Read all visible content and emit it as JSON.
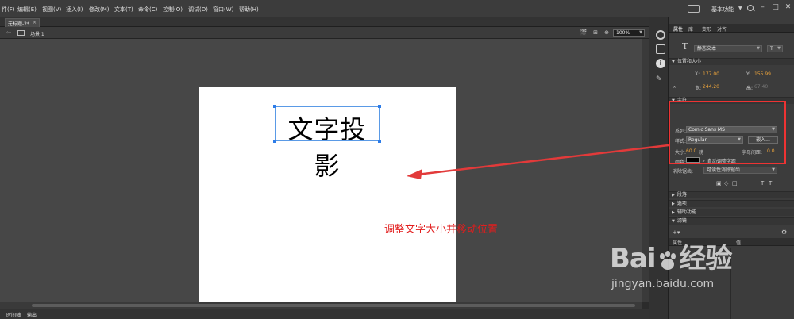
{
  "menu": [
    "件(F)",
    "编辑(E)",
    "视图(V)",
    "插入(I)",
    "修改(M)",
    "文本(T)",
    "命令(C)",
    "控制(O)",
    "调试(D)",
    "窗口(W)",
    "帮助(H)"
  ],
  "workspace": {
    "label": "基本功能",
    "arrow": "▼"
  },
  "window_buttons": [
    "–",
    "□",
    "✕"
  ],
  "document": {
    "tab_title": "无标题-2*",
    "tab_close": "×",
    "scene_label": "场景 1",
    "zoom": "100%",
    "stage_text": "文字投影",
    "annotation": "调整文字大小并移动位置"
  },
  "bottom_tabs": [
    "时间轴",
    "输出"
  ],
  "panel": {
    "tabs": [
      "属性",
      "库",
      "变形",
      "对齐"
    ],
    "text_tool_icon": "T",
    "text_type": "静态文本",
    "direction": "T",
    "sections": {
      "position_size": "位置和大小",
      "character": "字符",
      "paragraph": "段落",
      "options": "选项",
      "accessibility": "辅助功能",
      "filters": "滤镜"
    },
    "position": {
      "x_label": "X:",
      "x_value": "177.00",
      "y_label": "Y:",
      "y_value": "155.99",
      "w_label": "宽:",
      "w_value": "244.20",
      "h_label": "高:",
      "h_value": "67.40"
    },
    "character": {
      "family_label": "系列:",
      "family": "Comic Sans MS",
      "style_label": "样式:",
      "style": "Regular",
      "embed": "嵌入...",
      "size_label": "大小:",
      "size": "60.0",
      "size_unit": "磅",
      "spacing_label": "字母间距:",
      "spacing": "0.0",
      "color_label": "颜色:",
      "color": "#000000",
      "auto_kern": "✓ 自动调整字距",
      "aa_label": "消除锯齿:",
      "aa_value": "可读性消除锯齿"
    },
    "filter_columns": [
      "属性",
      "值"
    ]
  },
  "watermark": {
    "logo": "Bai",
    "logo_suffix": "经验",
    "url": "jingyan.baidu.com"
  }
}
